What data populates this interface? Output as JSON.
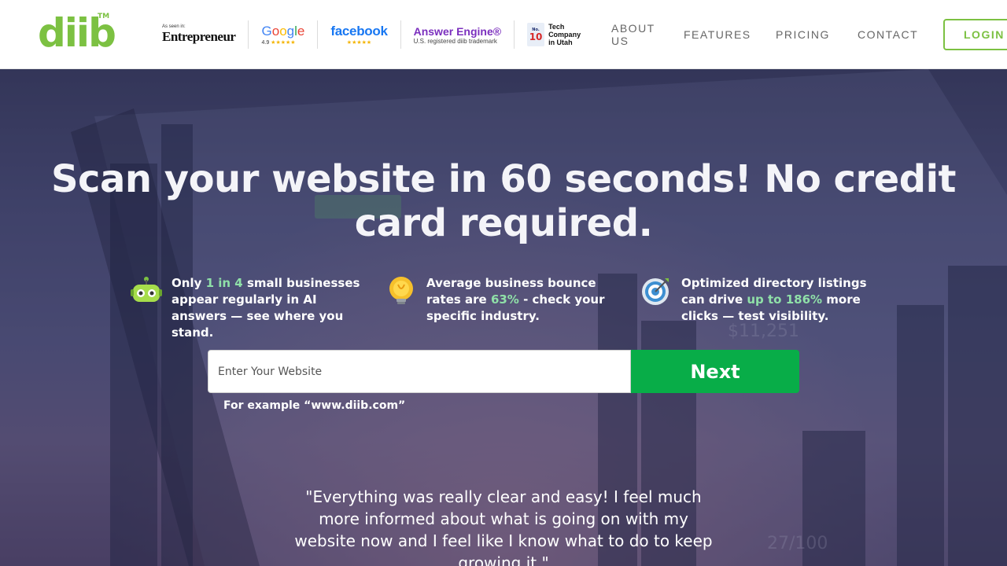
{
  "header": {
    "logo_text": "diib",
    "logo_tm": "TM",
    "badges": {
      "entrepreneur_small": "As seen in:",
      "entrepreneur_name": "Entrepreneur",
      "google_letters": [
        "G",
        "o",
        "o",
        "g",
        "l",
        "e"
      ],
      "google_rating": "4.9",
      "google_stars": "★★★★★",
      "facebook_name": "facebook",
      "facebook_stars": "★★★★★",
      "answer_engine_name": "Answer Engine®",
      "answer_engine_sub": "U.S. registered diib trademark",
      "tech_no": "No.",
      "tech_rank": "10",
      "tech_line1": "Tech",
      "tech_line2": "Company",
      "tech_line3": "in Utah"
    },
    "nav": {
      "about": "ABOUT US",
      "features": "FEATURES",
      "pricing": "PRICING",
      "contact": "CONTACT",
      "login": "LOGIN"
    }
  },
  "hero": {
    "title": "Scan your website in 60 seconds! No credit card required.",
    "features": [
      {
        "icon": "robot-icon",
        "pre": "Only ",
        "highlight": "1 in 4",
        "post": " small businesses appear regularly in AI answers — see where you stand."
      },
      {
        "icon": "lightbulb-icon",
        "pre": "Average business bounce rates are ",
        "highlight": "63%",
        "post": " - check your specific industry."
      },
      {
        "icon": "target-icon",
        "pre": "Optimized directory listings can drive ",
        "highlight": "up to 186%",
        "post": " more clicks — test visibility."
      }
    ],
    "search": {
      "placeholder": "Enter Your Website",
      "button": "Next",
      "example": "For example “www.diib.com”"
    },
    "testimonial": "\"Everything was really clear and easy! I feel much more informed about what is going on with my website now and I feel like I know what to do to keep growing it.\""
  },
  "colors": {
    "brand_green": "#7cc142",
    "next_button": "#08ad48",
    "highlight": "#8fe0a8"
  }
}
